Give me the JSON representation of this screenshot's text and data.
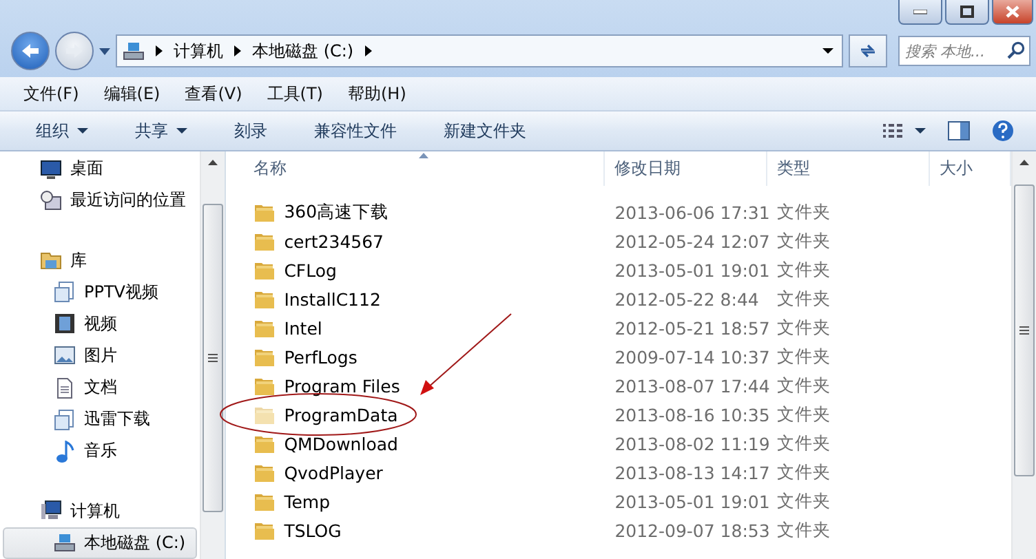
{
  "address": {
    "crumbs": [
      "计算机",
      "本地磁盘 (C:)"
    ]
  },
  "search": {
    "placeholder": "搜索 本地..."
  },
  "menu": [
    "文件(F)",
    "编辑(E)",
    "查看(V)",
    "工具(T)",
    "帮助(H)"
  ],
  "toolbar": [
    {
      "label": "组织",
      "dropdown": true
    },
    {
      "label": "共享",
      "dropdown": true
    },
    {
      "label": "刻录",
      "dropdown": false
    },
    {
      "label": "兼容性文件",
      "dropdown": false
    },
    {
      "label": "新建文件夹",
      "dropdown": false
    }
  ],
  "sidebar": {
    "items": [
      {
        "label": "桌面",
        "kind": "desktop",
        "selected": false
      },
      {
        "label": "最近访问的位置",
        "kind": "recent",
        "selected": false
      },
      {
        "label": "库",
        "kind": "library",
        "selected": false,
        "children": [
          {
            "label": "PPTV视频",
            "kind": "doclib",
            "selected": false
          },
          {
            "label": "视频",
            "kind": "film",
            "selected": false
          },
          {
            "label": "图片",
            "kind": "picture",
            "selected": false
          },
          {
            "label": "文档",
            "kind": "document",
            "selected": false
          },
          {
            "label": "迅雷下载",
            "kind": "doclib",
            "selected": false
          },
          {
            "label": "音乐",
            "kind": "music",
            "selected": false
          }
        ]
      },
      {
        "label": "计算机",
        "kind": "computer",
        "selected": false,
        "children": [
          {
            "label": "本地磁盘 (C:)",
            "kind": "drive",
            "selected": true
          }
        ]
      }
    ]
  },
  "table": {
    "columns": [
      "名称",
      "修改日期",
      "类型",
      "大小"
    ],
    "rows": [
      {
        "name": "360高速下载",
        "date": "2013-06-06 17:31",
        "type": "文件夹",
        "hidden": false
      },
      {
        "name": "cert234567",
        "date": "2012-05-24 12:07",
        "type": "文件夹",
        "hidden": false
      },
      {
        "name": "CFLog",
        "date": "2013-05-01 19:01",
        "type": "文件夹",
        "hidden": false
      },
      {
        "name": "InstallC112",
        "date": "2012-05-22 8:44",
        "type": "文件夹",
        "hidden": false
      },
      {
        "name": "Intel",
        "date": "2012-05-21 18:57",
        "type": "文件夹",
        "hidden": false
      },
      {
        "name": "PerfLogs",
        "date": "2009-07-14 10:37",
        "type": "文件夹",
        "hidden": false
      },
      {
        "name": "Program Files",
        "date": "2013-08-07 17:44",
        "type": "文件夹",
        "hidden": false
      },
      {
        "name": "ProgramData",
        "date": "2013-08-16 10:35",
        "type": "文件夹",
        "hidden": true
      },
      {
        "name": "QMDownload",
        "date": "2013-08-02 11:19",
        "type": "文件夹",
        "hidden": false
      },
      {
        "name": "QvodPlayer",
        "date": "2013-08-13 14:17",
        "type": "文件夹",
        "hidden": false
      },
      {
        "name": "Temp",
        "date": "2013-05-01 19:01",
        "type": "文件夹",
        "hidden": false
      },
      {
        "name": "TSLOG",
        "date": "2012-09-07 18:53",
        "type": "文件夹",
        "hidden": false
      }
    ]
  }
}
